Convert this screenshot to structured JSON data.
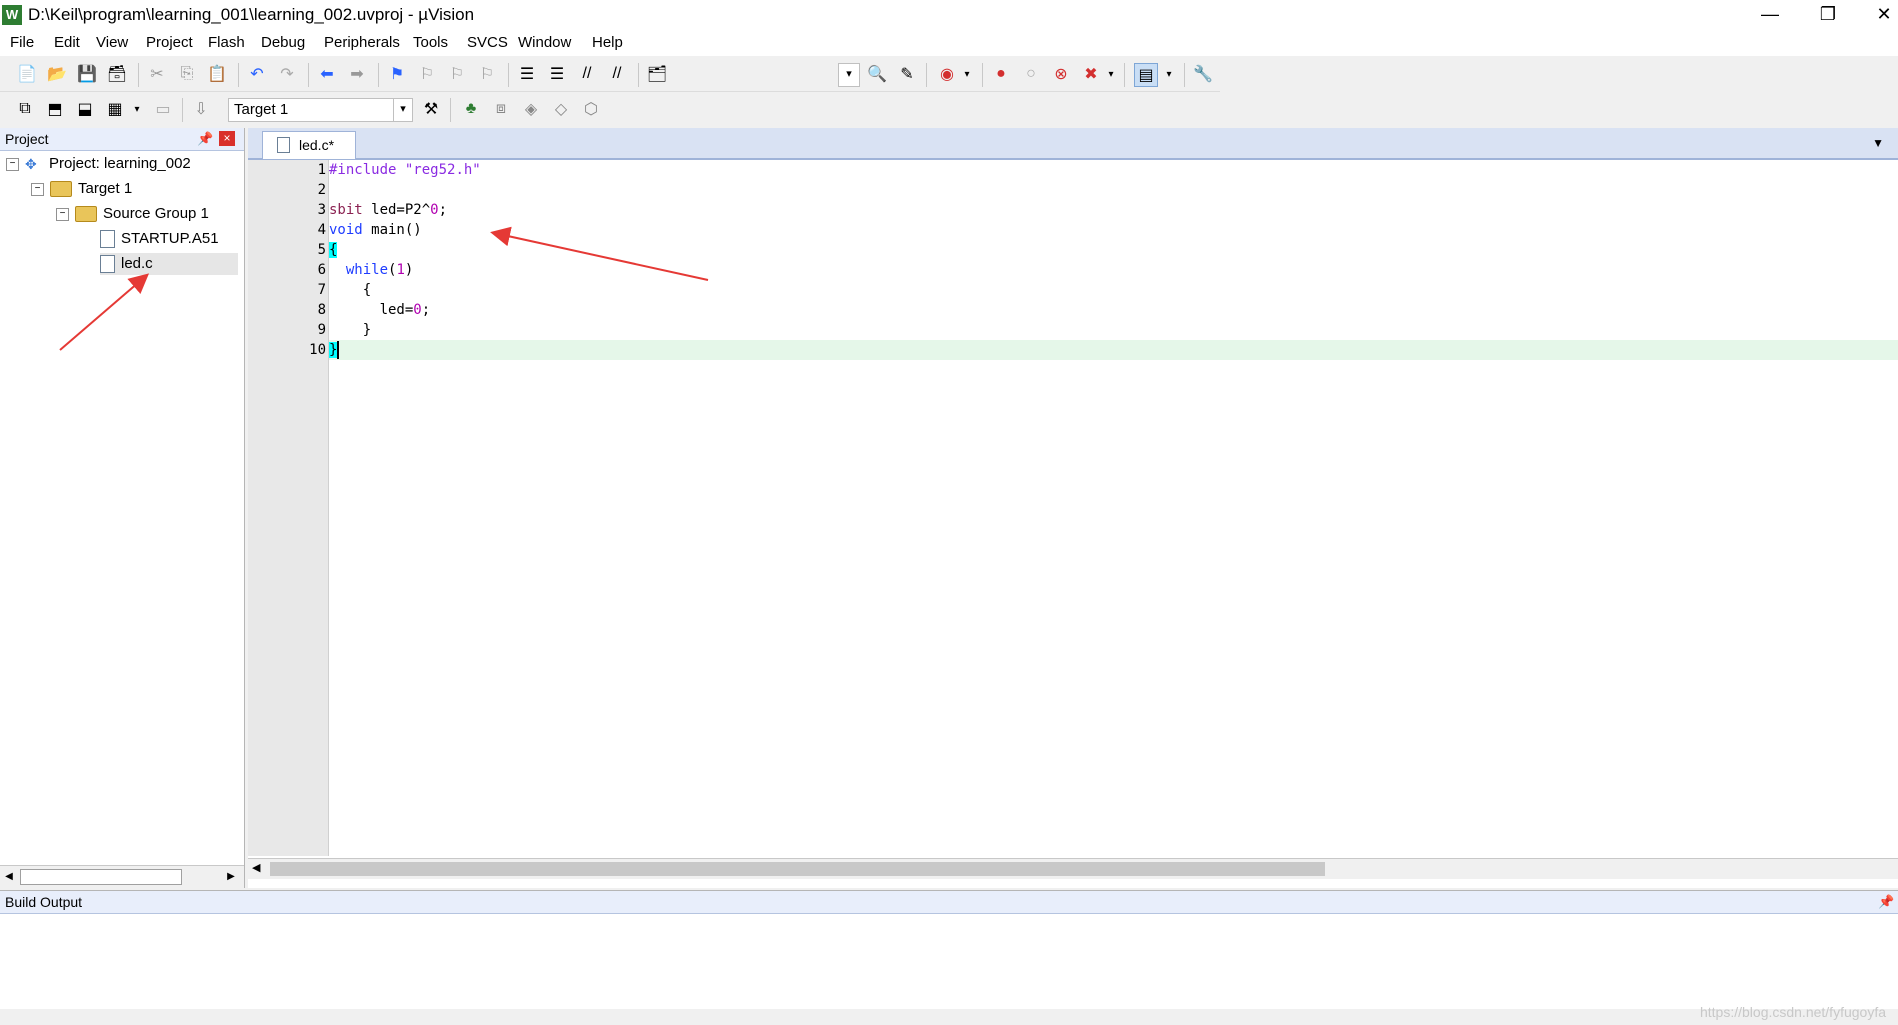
{
  "window": {
    "title": "D:\\Keil\\program\\learning_001\\learning_002.uvproj - µVision",
    "icon_label": "W",
    "minimize": "—",
    "restore": "❐",
    "close": "✕"
  },
  "menu": [
    "File",
    "Edit",
    "View",
    "Project",
    "Flash",
    "Debug",
    "Peripherals",
    "Tools",
    "SVCS",
    "Window",
    "Help"
  ],
  "toolbar2": {
    "target_select": "Target 1"
  },
  "project_panel": {
    "title": "Project",
    "pin": "📌",
    "close": "×",
    "tree": {
      "project": "Project: learning_002",
      "target": "Target 1",
      "group": "Source Group 1",
      "files": [
        "STARTUP.A51",
        "led.c"
      ]
    }
  },
  "editor": {
    "tab_label": "led.c*",
    "line_numbers": [
      "1",
      "2",
      "3",
      "4",
      "5",
      "6",
      "7",
      "8",
      "9",
      "10"
    ],
    "lines": {
      "l1_pp": "#include",
      "l1_str": " \"reg52.h\"",
      "l3_kw": "sbit",
      "l3_rest": " led=P2^",
      "l3_num": "0",
      "l3_end": ";",
      "l4_kw": "void",
      "l4_rest": " main()",
      "l5": "{",
      "l6_kw": "while",
      "l6_rest": "(",
      "l6_num": "1",
      "l6_end": ")",
      "l7": "    {",
      "l8_a": "      led=",
      "l8_num": "0",
      "l8_end": ";",
      "l9": "    }",
      "l10": "}"
    }
  },
  "build_output": {
    "title": "Build Output"
  },
  "watermark": "https://blog.csdn.net/fyfugoyfa",
  "colors": {
    "annotation_arrow": "#e53935",
    "active_line": "#e5f7e9",
    "brace_highlight": "#00ffff"
  }
}
